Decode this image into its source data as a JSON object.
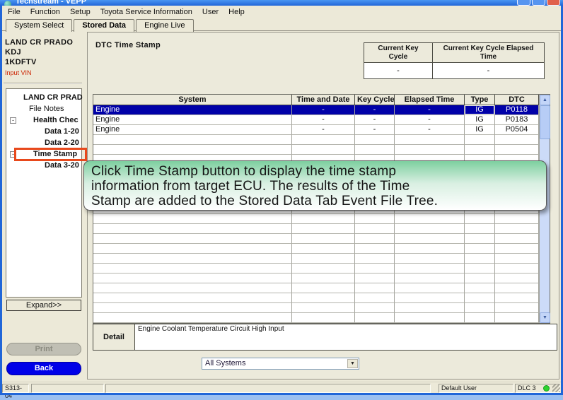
{
  "window": {
    "title": "Techstream - VEPP"
  },
  "menu": {
    "items": [
      "File",
      "Function",
      "Setup",
      "Toyota Service Information",
      "User",
      "Help"
    ]
  },
  "tabs": {
    "items": [
      {
        "label": "System Select",
        "active": false
      },
      {
        "label": "Stored Data",
        "active": true
      },
      {
        "label": "Engine Live",
        "active": false
      }
    ]
  },
  "sidebar": {
    "vehicle_lines": [
      "LAND CR PRADO",
      "KDJ",
      "1KDFTV"
    ],
    "input_vin": "Input VIN",
    "tree": {
      "items": [
        {
          "label": "LAND CR PRAD",
          "bold": true,
          "indent": 0,
          "collapsible": false,
          "highlighted": false
        },
        {
          "label": "File Notes",
          "bold": false,
          "indent": 1,
          "collapsible": false,
          "highlighted": false
        },
        {
          "label": "Health Chec",
          "bold": true,
          "indent": 2,
          "collapsible": true,
          "highlighted": false
        },
        {
          "label": "Data 1-20",
          "bold": true,
          "indent": 3,
          "collapsible": false,
          "highlighted": false
        },
        {
          "label": "Data 2-20",
          "bold": true,
          "indent": 3,
          "collapsible": false,
          "highlighted": false
        },
        {
          "label": "Time Stamp",
          "bold": true,
          "indent": 2,
          "collapsible": true,
          "highlighted": true
        },
        {
          "label": "Data 3-20",
          "bold": true,
          "indent": 3,
          "collapsible": false,
          "highlighted": false
        }
      ]
    },
    "expand_button": "Expand>>",
    "print_button": "Print",
    "back_button": "Back"
  },
  "main": {
    "title": "DTC Time Stamp",
    "key_cycle_table": {
      "headers": [
        "Current Key Cycle",
        "Current Key Cycle Elapsed Time"
      ],
      "values": [
        "-",
        "-"
      ]
    },
    "dtc_table": {
      "headers": [
        "System",
        "Time and Date",
        "Key Cycle",
        "Elapsed Time",
        "Type",
        "DTC"
      ],
      "rows": [
        {
          "system": "Engine",
          "time_and_date": "-",
          "key_cycle": "-",
          "elapsed_time": "-",
          "type": "IG",
          "dtc": "P0118",
          "selected": true
        },
        {
          "system": "Engine",
          "time_and_date": "-",
          "key_cycle": "-",
          "elapsed_time": "-",
          "type": "IG",
          "dtc": "P0183",
          "selected": false
        },
        {
          "system": "Engine",
          "time_and_date": "-",
          "key_cycle": "-",
          "elapsed_time": "-",
          "type": "IG",
          "dtc": "P0504",
          "selected": false
        }
      ],
      "empty_row_count": 19
    },
    "tooltip_lines": [
      "Click Time Stamp button to display the time stamp",
      "information from target ECU. The results of the Time",
      "Stamp are added to the Stored Data Tab Event File Tree."
    ],
    "detail": {
      "label": "Detail",
      "text": "Engine Coolant Temperature Circuit High Input"
    },
    "system_filter_value": "All Systems"
  },
  "statusbar": {
    "code": "S313-04",
    "user": "Default User",
    "connection": "DLC 3"
  },
  "colors": {
    "selected_row": "#0000a8",
    "tree_highlight": "#e8491c",
    "back_button": "#0000e8",
    "status_dot": "#2ed330",
    "tooltip_top": "#7dcf9f",
    "title_bar": "#2166d8"
  }
}
